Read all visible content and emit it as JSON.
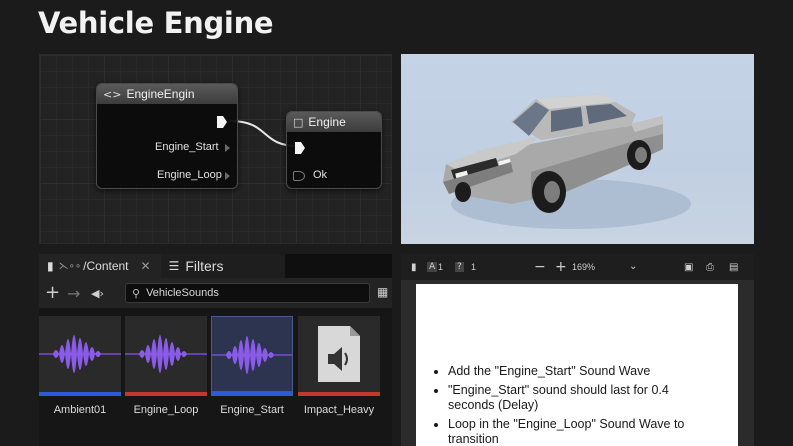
{
  "page": {
    "title": "Vehicle Engine"
  },
  "graph": {
    "node_getter": {
      "title": "EngineEngin",
      "pins": [
        "Engine_Start",
        "Engine_Loop"
      ]
    },
    "node_engine": {
      "title": "Engine",
      "pins": [
        "Ok"
      ]
    }
  },
  "content_browser": {
    "tab_content": "/Content",
    "tab_filters": "Filters",
    "search_value": "VehicleSounds",
    "assets": [
      {
        "label": "Ambient01",
        "bar_color": "#2a5bd7",
        "type": "sound-wave"
      },
      {
        "label": "Engine_Loop",
        "bar_color": "#c0392b",
        "type": "sound-wave"
      },
      {
        "label": "Engine_Start",
        "bar_color": "#2a5bd7",
        "type": "sound-wave",
        "selected": true
      },
      {
        "label": "Impact_Heavy",
        "bar_color": "#c0392b",
        "type": "sound-file"
      }
    ]
  },
  "doc_viewer": {
    "page_current": "1",
    "page_total": "1",
    "zoom": "169%",
    "bullets": [
      "Add the \"Engine_Start\" Sound Wave",
      "\"Engine_Start\" sound should last for 0.4 seconds (Delay)",
      "Loop in the \"Engine_Loop\" Sound Wave to transition"
    ]
  }
}
